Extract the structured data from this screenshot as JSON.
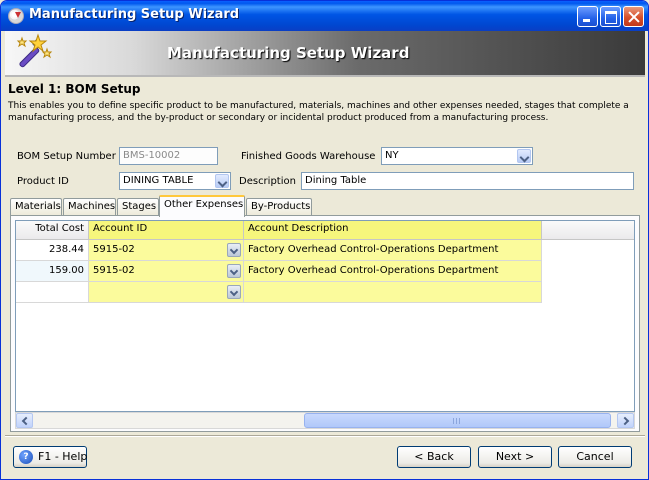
{
  "window": {
    "title": "Manufacturing Setup Wizard"
  },
  "banner": {
    "title": "Manufacturing Setup Wizard"
  },
  "level": {
    "title": "Level 1: BOM Setup",
    "description": "This enables you to define specific product to be manufactured, materials, machines and other expenses needed, stages that complete a manufacturing process, and the by-product or secondary or incidental product produced from a manufacturing process."
  },
  "form": {
    "bom_setup_number_label": "BOM Setup Number",
    "bom_setup_number_value": "BMS-10002",
    "finished_goods_warehouse_label": "Finished Goods Warehouse",
    "finished_goods_warehouse_value": "NY",
    "product_id_label": "Product ID",
    "product_id_value": "DINING TABLE",
    "description_label": "Description",
    "description_value": "Dining Table"
  },
  "tabs": [
    {
      "label": "Materials",
      "active": false
    },
    {
      "label": "Machines",
      "active": false
    },
    {
      "label": "Stages",
      "active": false
    },
    {
      "label": "Other Expenses",
      "active": true
    },
    {
      "label": "By-Products",
      "active": false
    }
  ],
  "grid": {
    "columns": [
      "Total Cost",
      "Account ID",
      "Account Description"
    ],
    "rows": [
      {
        "total_cost": "238.44",
        "account_id": "5915-02",
        "account_description": "Factory Overhead Control-Operations Department"
      },
      {
        "total_cost": "159.00",
        "account_id": "5915-02",
        "account_description": "Factory Overhead Control-Operations Department"
      },
      {
        "total_cost": "",
        "account_id": "",
        "account_description": ""
      }
    ],
    "highlight_color": "#fbfb9c"
  },
  "buttons": {
    "help": "F1 - Help",
    "help_icon": "?",
    "back": "< Back",
    "next": "Next >",
    "cancel": "Cancel"
  }
}
